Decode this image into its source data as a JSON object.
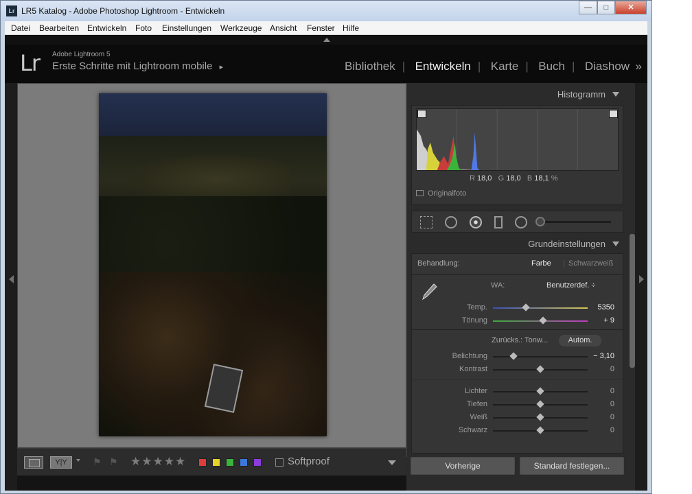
{
  "window": {
    "title": "LR5 Katalog - Adobe Photoshop Lightroom - Entwickeln",
    "app_icon": "Lr",
    "minimize_glyph": "—",
    "maximize_glyph": "□",
    "close_glyph": "✕"
  },
  "menu": [
    "Datei",
    "Bearbeiten",
    "Entwickeln",
    "Foto",
    "Einstellungen",
    "Werkzeuge",
    "Ansicht",
    "Fenster",
    "Hilfe"
  ],
  "identity": {
    "logo": "Lr",
    "product": "Adobe Lightroom 5",
    "catalog": "Erste Schritte mit Lightroom mobile",
    "catalog_arrow": "▸"
  },
  "modules": {
    "items": [
      "Bibliothek",
      "Entwickeln",
      "Karte",
      "Buch",
      "Diashow"
    ],
    "active": "Entwickeln",
    "more": "»"
  },
  "toolbar": {
    "compare_label": "Y|Y",
    "stars": "★★★★★",
    "color_labels": [
      "#e03c3c",
      "#e6d22a",
      "#3cb43c",
      "#3c78dc",
      "#8c3cdc"
    ],
    "softproof_label": "Softproof"
  },
  "histogram": {
    "title": "Histogramm",
    "r_label": "R",
    "r": "18,0",
    "g_label": "G",
    "g": "18,0",
    "b_label": "B",
    "b": "18,1",
    "unit": "%",
    "original_label": "Originalfoto"
  },
  "basic": {
    "title": "Grundeinstellungen",
    "treatment_label": "Behandlung:",
    "color": "Farbe",
    "bw": "Schwarzweiß",
    "wb_label": "WA:",
    "wb_value": "Benutzerdef. ÷",
    "temp_label": "Temp.",
    "temp_value": "5350",
    "temp_pos": 0.35,
    "tint_label": "Tönung",
    "tint_value": "+ 9",
    "tint_pos": 0.53,
    "reset_tone": "Zurücks.: Tonw...",
    "auto": "Autom.",
    "exposure_label": "Belichtung",
    "exposure_value": "− 3,10",
    "exposure_pos": 0.22,
    "contrast_label": "Kontrast",
    "contrast_value": "0",
    "highlights_label": "Lichter",
    "highlights_value": "0",
    "shadows_label": "Tiefen",
    "shadows_value": "0",
    "whites_label": "Weiß",
    "whites_value": "0",
    "blacks_label": "Schwarz",
    "blacks_value": "0"
  },
  "buttons": {
    "previous": "Vorherige",
    "set_default": "Standard festlegen..."
  }
}
